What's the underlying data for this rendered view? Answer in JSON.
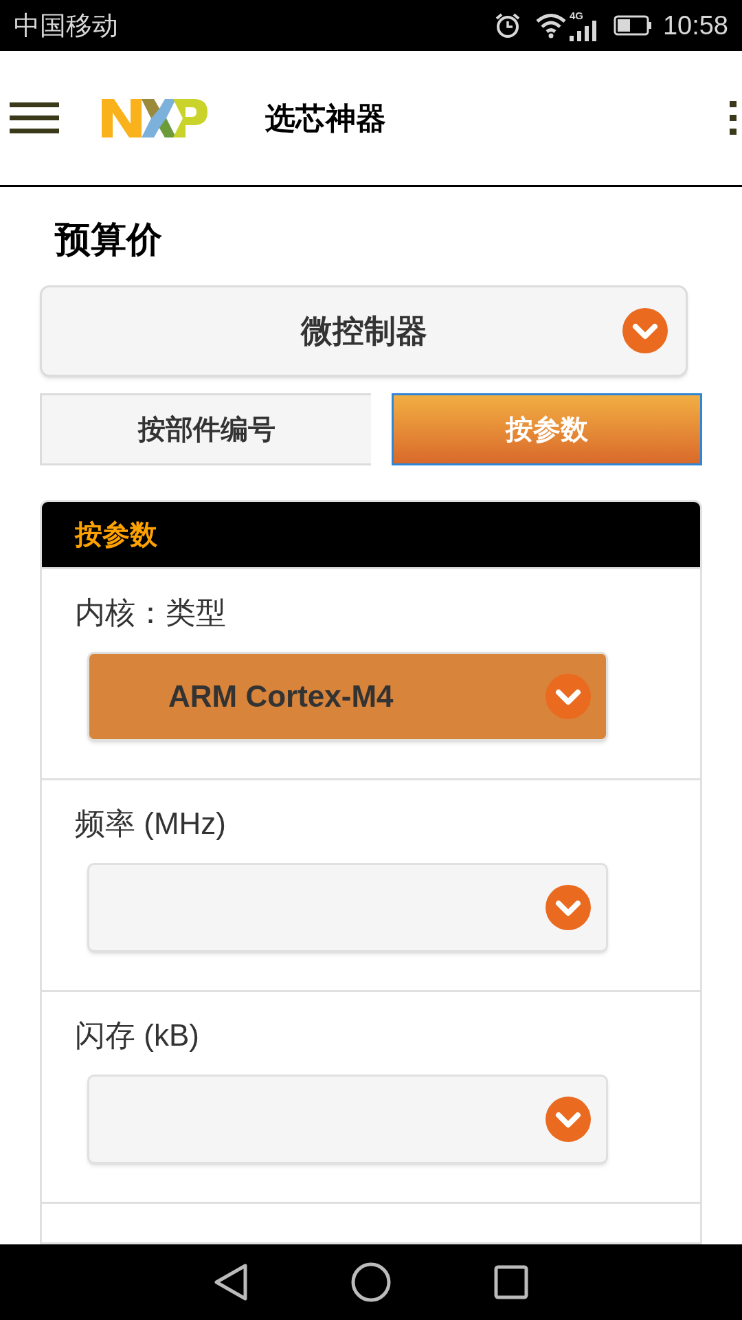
{
  "status_bar": {
    "carrier": "中国移动",
    "network": "4G",
    "time": "10:58"
  },
  "header": {
    "title": "选芯神器"
  },
  "page_title": "预算价",
  "category_select": {
    "value": "微控制器"
  },
  "tabs": [
    {
      "label": "按部件编号",
      "selected": false
    },
    {
      "label": "按参数",
      "selected": true
    }
  ],
  "panel": {
    "title": "按参数",
    "filters": [
      {
        "label": "内核：类型",
        "value": "ARM Cortex-M4",
        "active": true
      },
      {
        "label": "频率 (MHz)",
        "active": false
      },
      {
        "label": "闪存 (kB)",
        "active": false
      }
    ]
  }
}
